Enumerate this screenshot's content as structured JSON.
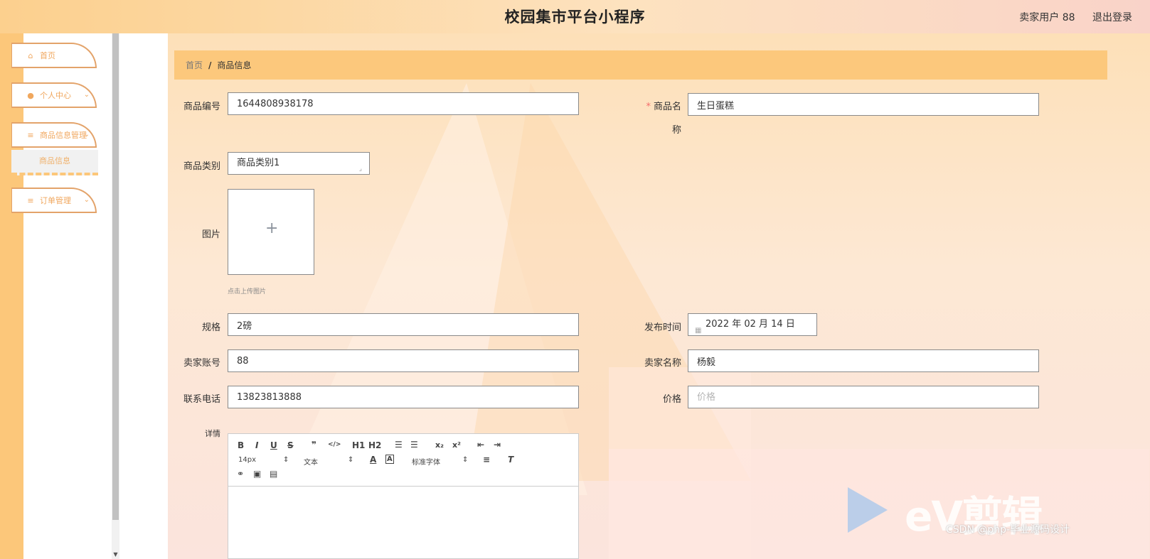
{
  "header": {
    "title": "校园集市平台小程序",
    "user": "卖家用户 88",
    "logout": "退出登录"
  },
  "sidebar": {
    "items": [
      {
        "label": "首页",
        "icon": "home-icon"
      },
      {
        "label": "个人中心",
        "icon": "user-icon"
      },
      {
        "label": "商品信息管理",
        "icon": "menu-icon"
      },
      {
        "label": "订单管理",
        "icon": "menu-icon"
      }
    ],
    "submenu": {
      "label": "商品信息"
    }
  },
  "breadcrumb": {
    "home": "首页",
    "separator": "/",
    "current": "商品信息"
  },
  "form": {
    "product_no": {
      "label": "商品编号",
      "value": "1644808938178"
    },
    "product_name": {
      "label_part1": "商品名",
      "label_part2": "称",
      "value": "生日蛋糕",
      "required_mark": "*"
    },
    "category": {
      "label": "商品类别",
      "value": "商品类别1"
    },
    "image": {
      "label": "图片",
      "tip": "点击上传图片"
    },
    "spec": {
      "label": "规格",
      "value": "2磅"
    },
    "publish_time": {
      "label": "发布时间",
      "value": "2022 年 02 月 14 日"
    },
    "seller_account": {
      "label": "卖家账号",
      "value": "88"
    },
    "seller_name": {
      "label": "卖家名称",
      "value": "杨毅"
    },
    "phone": {
      "label": "联系电话",
      "value": "13823813888"
    },
    "price": {
      "label": "价格",
      "placeholder": "价格"
    },
    "details": {
      "label": "详情",
      "toolbar": {
        "bold": "B",
        "italic": "I",
        "underline": "U",
        "strike": "S",
        "quote": "❞",
        "code": "</>",
        "h1": "H1",
        "h2": "H2",
        "sub": "x₂",
        "sup": "x²",
        "size": "14px",
        "type": "文本",
        "font": "标准字体"
      }
    }
  },
  "watermark": {
    "brand": "eV剪辑",
    "credit": "CSDN @php-毕业源码设计"
  },
  "colors": {
    "accent": "#fcc87c",
    "sidebar_text": "#f0a75e",
    "required": "#f56c6c"
  }
}
